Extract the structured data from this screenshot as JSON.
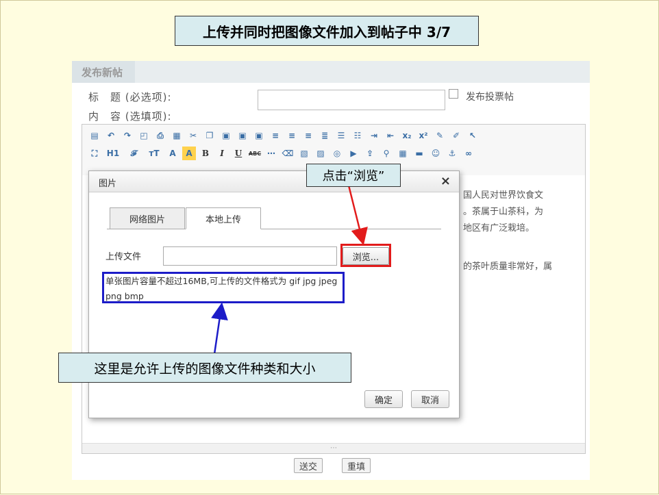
{
  "slide": {
    "title": "上传并同时把图像文件加入到帖子中 3/7"
  },
  "panel": {
    "header_tab": "发布新帖",
    "subject_label": "标　题 (必选项):",
    "content_label": "内　容 (选填项):",
    "poll_label": "发布投票帖"
  },
  "toolbar": {
    "heading": "H1",
    "font": "𝓕",
    "size": "тT",
    "color": "A",
    "highlight": "A",
    "bold": "B",
    "italic": "I",
    "underline": "U",
    "strike": "ABC"
  },
  "editor": {
    "line1": "国人民对世界饮食文",
    "line2": "。茶属于山茶科，为",
    "line3": "地区有广泛栽培。",
    "line4": "的茶叶质量非常好，属"
  },
  "footer": {
    "submit": "送交",
    "reset": "重填"
  },
  "dialog": {
    "title": "图片",
    "close": "×",
    "tab_network": "网络图片",
    "tab_local": "本地上传",
    "upload_label": "上传文件",
    "browse": "浏览...",
    "hint": "单张图片容量不超过16MB,可上传的文件格式为 gif jpg jpeg png bmp",
    "ok": "确定",
    "cancel": "取消"
  },
  "callouts": {
    "browse": "点击“浏览”",
    "types": "这里是允许上传的图像文件种类和大小"
  },
  "colors": {
    "slide_bg": "#fffde0",
    "callout_bg": "#d8ecef",
    "red_highlight": "#e21b1b",
    "blue_highlight": "#1c1cc8"
  }
}
